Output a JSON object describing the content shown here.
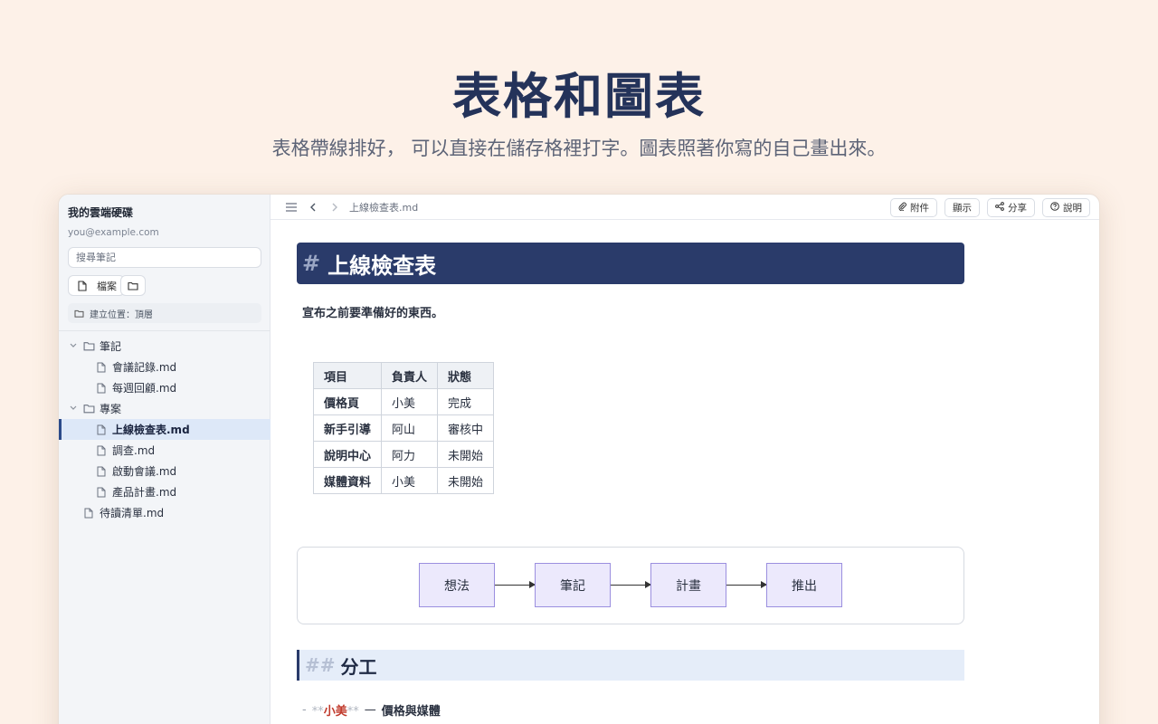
{
  "hero": {
    "title": "表格和圖表",
    "subtitle": "表格帶線排好， 可以直接在儲存格裡打字。圖表照著你寫的自己畫出來。"
  },
  "sidebar": {
    "drive_name": "我的雲端硬碟",
    "email": "you@example.com",
    "search_placeholder": "搜尋筆記",
    "new_file_label": "檔案",
    "location_label": "建立位置：頂層",
    "tree": [
      {
        "label": "筆記",
        "type": "folder",
        "expanded": true,
        "depth": 0
      },
      {
        "label": "會議記錄.md",
        "type": "file",
        "depth": 1
      },
      {
        "label": "每週回顧.md",
        "type": "file",
        "depth": 1
      },
      {
        "label": "專案",
        "type": "folder",
        "expanded": true,
        "depth": 0
      },
      {
        "label": "上線檢查表.md",
        "type": "file",
        "depth": 1,
        "active": true
      },
      {
        "label": "調查.md",
        "type": "file",
        "depth": 1
      },
      {
        "label": "啟動會議.md",
        "type": "file",
        "depth": 1
      },
      {
        "label": "產品計畫.md",
        "type": "file",
        "depth": 1
      },
      {
        "label": "待讀清單.md",
        "type": "file",
        "depth": 0
      }
    ]
  },
  "toolbar": {
    "breadcrumb": "上線檢查表.md",
    "attach_label": "附件",
    "display_label": "顯示",
    "share_label": "分享",
    "help_label": "說明"
  },
  "doc": {
    "h1_hash": "#",
    "h1": "上線檢查表",
    "intro": "宣布之前要準備好的東西。",
    "table": {
      "headers": [
        "項目",
        "負責人",
        "狀態"
      ],
      "rows": [
        [
          "價格頁",
          "小美",
          "完成"
        ],
        [
          "新手引導",
          "阿山",
          "審核中"
        ],
        [
          "說明中心",
          "阿力",
          "未開始"
        ],
        [
          "媒體資料",
          "小美",
          "未開始"
        ]
      ]
    },
    "diagram": {
      "nodes": [
        "想法",
        "筆記",
        "計畫",
        "推出"
      ]
    },
    "h2_hash": "##",
    "h2": "分工",
    "list": [
      {
        "dash": "-",
        "stars": "**",
        "who": "小美",
        "sep": "—",
        "task": "價格與媒體"
      }
    ]
  },
  "colors": {
    "background": "#fdf1e8",
    "heading": "#24335a",
    "h1_bg": "#2a3b6a",
    "node_fill": "#ece9fc",
    "node_border": "#9b8fdf",
    "name_red": "#c0392b"
  }
}
